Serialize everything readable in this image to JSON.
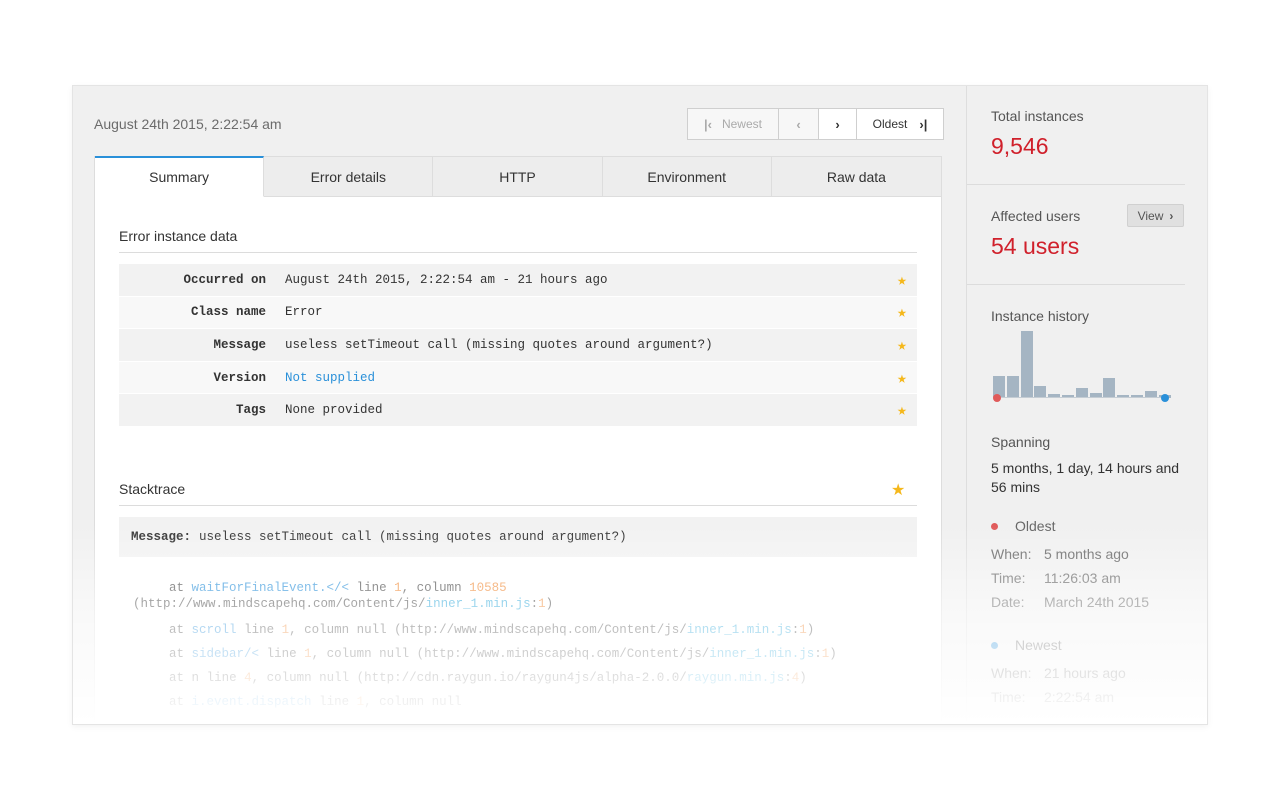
{
  "header": {
    "date": "August 24th 2015, 2:22:54 am"
  },
  "pager": {
    "newest_label": "Newest",
    "oldest_label": "Oldest"
  },
  "tabs": [
    {
      "label": "Summary",
      "active": true
    },
    {
      "label": "Error details",
      "active": false
    },
    {
      "label": "HTTP",
      "active": false
    },
    {
      "label": "Environment",
      "active": false
    },
    {
      "label": "Raw data",
      "active": false
    }
  ],
  "instance": {
    "title": "Error instance data",
    "rows": [
      {
        "label": "Occurred on",
        "value": "August 24th 2015, 2:22:54 am - 21 hours ago"
      },
      {
        "label": "Class name",
        "value": "Error"
      },
      {
        "label": "Message",
        "value": "useless setTimeout call (missing quotes around argument?)"
      },
      {
        "label": "Version",
        "value": "Not supplied"
      },
      {
        "label": "Tags",
        "value": "None provided"
      }
    ]
  },
  "stacktrace": {
    "title": "Stacktrace",
    "message_label": "Message:",
    "message": "useless setTimeout call (missing quotes around argument?)",
    "lines": [
      {
        "at": "at",
        "fn": "waitForFinalEvent.</<",
        "line_word": "line",
        "line": "1",
        "col_word": ", column",
        "col": "10585",
        "url": "(http://www.mindscapehq.com/Content/js/",
        "file": "inner_1.min.js",
        "sep": ":",
        "pos": "1",
        "close": ")"
      },
      {
        "at": "at",
        "fn": "scroll",
        "line_word": "line",
        "line": "1",
        "col_word": ", column null",
        "col": "",
        "url": "(http://www.mindscapehq.com/Content/js/",
        "file": "inner_1.min.js",
        "sep": ":",
        "pos": "1",
        "close": ")"
      },
      {
        "at": "at",
        "fn": "sidebar/<",
        "line_word": "line",
        "line": "1",
        "col_word": ", column null",
        "col": "",
        "url": "(http://www.mindscapehq.com/Content/js/",
        "file": "inner_1.min.js",
        "sep": ":",
        "pos": "1",
        "close": ")"
      },
      {
        "at": "at",
        "fn": "n",
        "line_word": "line",
        "line": "4",
        "col_word": ", column null",
        "col": "",
        "url": "(http://cdn.raygun.io/raygun4js/alpha-2.0.0/",
        "file": "raygun.min.js",
        "sep": ":",
        "pos": "4",
        "close": ")"
      },
      {
        "at": "at",
        "fn": "i.event.dispatch",
        "line_word": "line",
        "line": "1",
        "col_word": ", column null",
        "col": "",
        "url": "",
        "file": "",
        "sep": "",
        "pos": "",
        "close": ""
      }
    ]
  },
  "sidebar": {
    "total_label": "Total instances",
    "total_value": "9,546",
    "affected_label": "Affected users",
    "affected_value": "54 users",
    "view_label": "View",
    "history_label": "Instance history",
    "history_values": [
      0.32,
      0.32,
      0.98,
      0.18,
      0.06,
      0.04,
      0.15,
      0.08,
      0.3,
      0.05,
      0.05,
      0.1,
      0.05
    ],
    "spanning_label": "Spanning",
    "spanning_value": "5 months, 1 day, 14 hours and 56 mins",
    "oldest": {
      "label": "Oldest",
      "when_k": "When:",
      "when_v": "5 months ago",
      "time_k": "Time:",
      "time_v": "11:26:03 am",
      "date_k": "Date:",
      "date_v": "March 24th 2015"
    },
    "newest": {
      "label": "Newest",
      "when_k": "When:",
      "when_v": "21 hours ago",
      "time_k": "Time:",
      "time_v": "2:22:54 am"
    },
    "colors": {
      "oldest_dot": "#e05a5a",
      "newest_dot": "#2a90d9",
      "accent_red": "#d0202b"
    }
  }
}
